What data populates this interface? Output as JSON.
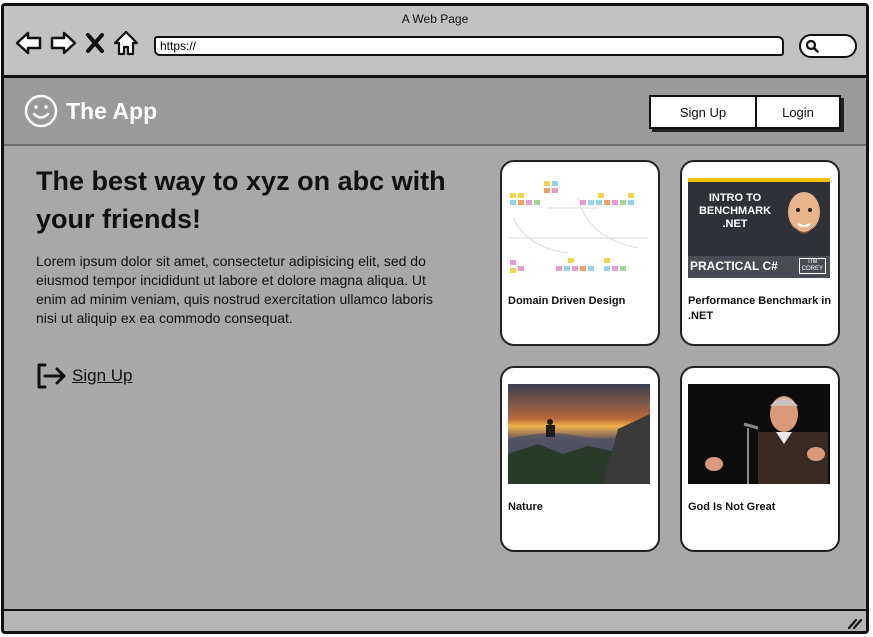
{
  "browser": {
    "window_title": "A Web Page",
    "url": "https://",
    "nav_icons": [
      "back-arrow-icon",
      "forward-arrow-icon",
      "close-x-icon",
      "home-icon"
    ],
    "search_icon": "magnifier-icon"
  },
  "header": {
    "logo_icon": "smiley-icon",
    "app_name": "The App",
    "signup_label": "Sign Up",
    "login_label": "Login"
  },
  "hero": {
    "title": "The best way to xyz on abc with your friends!",
    "body": "Lorem ipsum dolor sit amet, consectetur adipisicing elit, sed do eiusmod tempor incididunt ut labore et dolore magna aliqua. Ut enim ad minim veniam, quis nostrud exercitation ullamco laboris nisi ut aliquip ex ea commodo consequat.",
    "cta_icon": "sign-in-icon",
    "cta_label": "Sign Up"
  },
  "cards": [
    {
      "title": "Domain Driven Design",
      "image": "ddd-sticky-notes-diagram"
    },
    {
      "title": "Performance Benchmark in .NET",
      "image": "benchmark-thumbnail",
      "image_text": [
        "INTRO TO",
        "BENCHMARK",
        ".NET",
        "PRACTICAL C#",
        "TIM",
        "COREY"
      ]
    },
    {
      "title": "Nature",
      "image": "mountain-sunset-photo"
    },
    {
      "title": "God Is Not Great",
      "image": "speaker-at-microphone-photo"
    }
  ],
  "colors": {
    "page_bg": "#a8a8a8",
    "header_bg": "#9a9a9a",
    "chrome_bg": "#c2c2c2",
    "card_bg": "#ffffff",
    "thumbnail_yellow": "#f2c200"
  }
}
